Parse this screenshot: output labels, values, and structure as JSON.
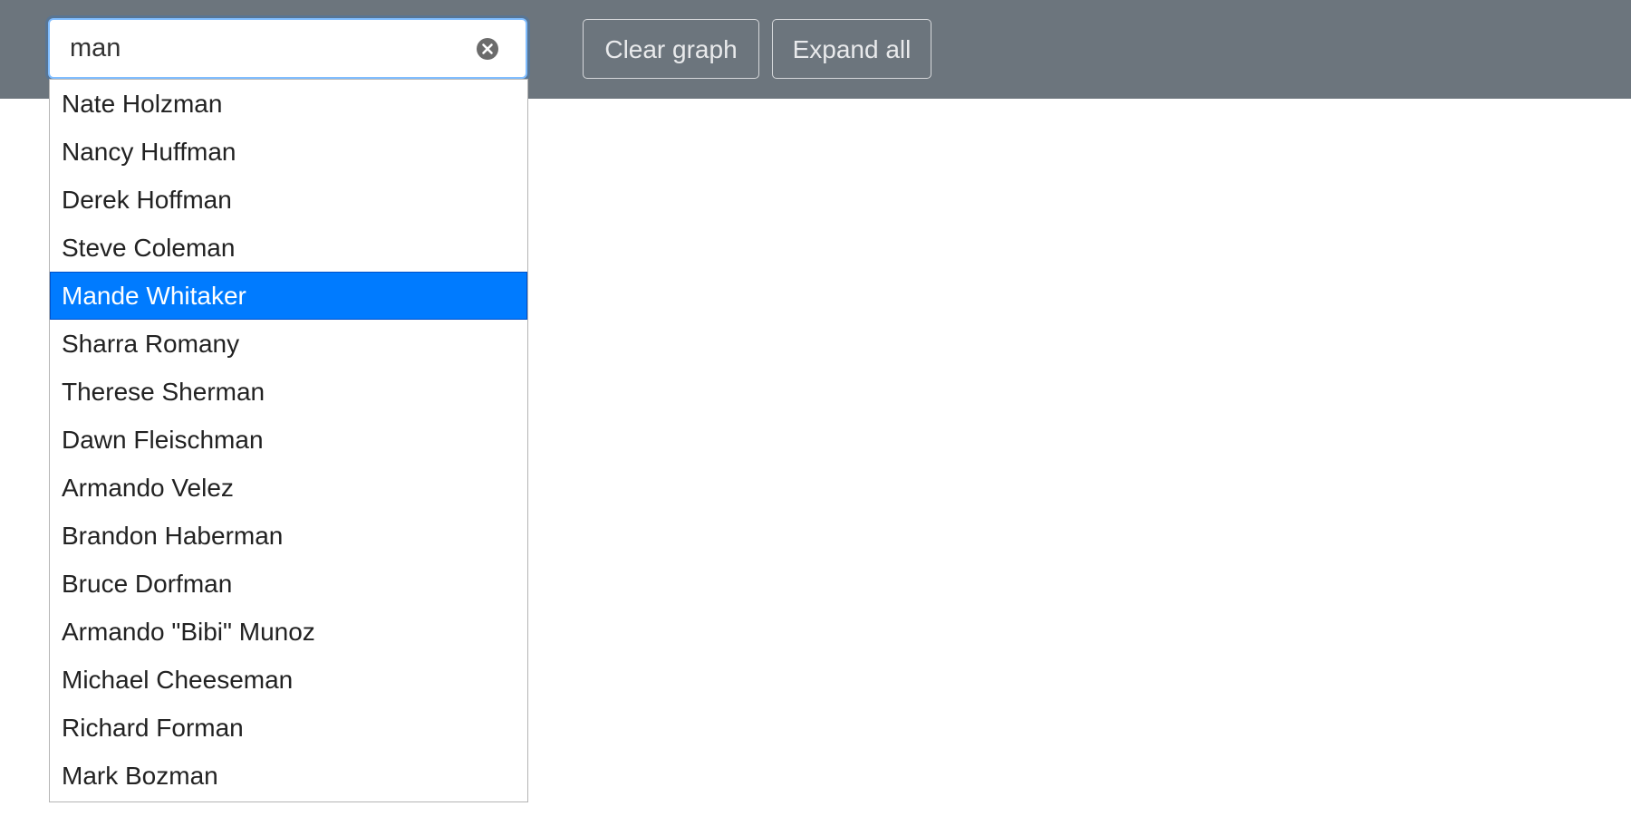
{
  "toolbar": {
    "search": {
      "value": "man",
      "placeholder": ""
    },
    "clear_graph_label": "Clear graph",
    "expand_all_label": "Expand all"
  },
  "suggestions": {
    "active_index": 4,
    "items": [
      "Nate Holzman",
      "Nancy Huffman",
      "Derek Hoffman",
      "Steve Coleman",
      "Mande Whitaker",
      "Sharra Romany",
      "Therese Sherman",
      "Dawn Fleischman",
      "Armando Velez",
      "Brandon Haberman",
      "Bruce Dorfman",
      "Armando \"Bibi\" Munoz",
      "Michael Cheeseman",
      "Richard Forman",
      "Mark Bozman"
    ]
  },
  "icons": {
    "clear_input": "circle-x-icon"
  },
  "colors": {
    "toolbar_bg": "#6c757d",
    "active_suggestion_bg": "#007bff",
    "input_focus_border": "#80bdff"
  }
}
